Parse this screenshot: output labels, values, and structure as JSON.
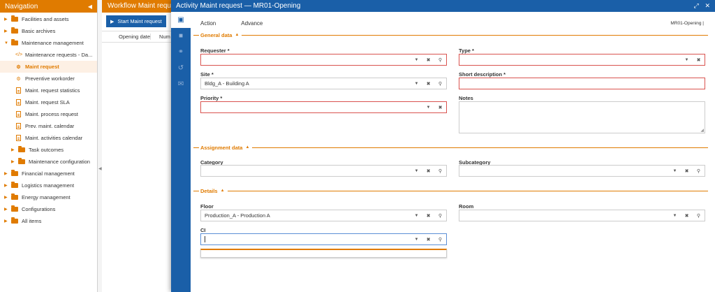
{
  "navigation": {
    "title": "Navigation",
    "collapse_icon": "chevron-left-icon",
    "items": [
      {
        "label": "Facilities and assets"
      },
      {
        "label": "Basic archives"
      },
      {
        "label": "Maintenance management"
      },
      {
        "label": "Maintenance requests - Da..."
      },
      {
        "label": "Maint request"
      },
      {
        "label": "Preventive workorder"
      },
      {
        "label": "Maint. request statistics"
      },
      {
        "label": "Maint. request SLA"
      },
      {
        "label": "Maint. process request"
      },
      {
        "label": "Prev. maint. calendar"
      },
      {
        "label": "Maint. activities calendar"
      },
      {
        "label": "Task outcomes"
      },
      {
        "label": "Maintenance configuration"
      },
      {
        "label": "Financial management"
      },
      {
        "label": "Logistics management"
      },
      {
        "label": "Energy management"
      },
      {
        "label": "Configurations"
      },
      {
        "label": "All items"
      }
    ]
  },
  "workflow": {
    "title": "Workflow Maint request",
    "start_button": "Start Maint request",
    "columns": [
      "Opening date",
      "Num"
    ]
  },
  "modal": {
    "title": "Activity Maint request — MR01-Opening",
    "tabs": [
      "Action",
      "Advance"
    ],
    "card_code": "MR01-Opening |",
    "sections": {
      "general": "General data",
      "assignment": "Assignment data",
      "details": "Details"
    },
    "fields": {
      "requester": {
        "label": "Requester *",
        "value": ""
      },
      "type": {
        "label": "Type *",
        "value": ""
      },
      "site": {
        "label": "Site *",
        "value": "Bldg_A - Building A"
      },
      "short_description": {
        "label": "Short description *",
        "value": ""
      },
      "priority": {
        "label": "Priority *",
        "value": ""
      },
      "notes": {
        "label": "Notes",
        "value": ""
      },
      "category": {
        "label": "Category",
        "value": ""
      },
      "subcategory": {
        "label": "Subcategory",
        "value": ""
      },
      "floor": {
        "label": "Floor",
        "value": "Production_A - Production A"
      },
      "room": {
        "label": "Room",
        "value": ""
      },
      "ci": {
        "label": "CI",
        "value": ""
      }
    }
  },
  "colors": {
    "accent_orange": "#e07b00",
    "primary_blue": "#1a5fa8",
    "required_red": "#d9534f"
  }
}
